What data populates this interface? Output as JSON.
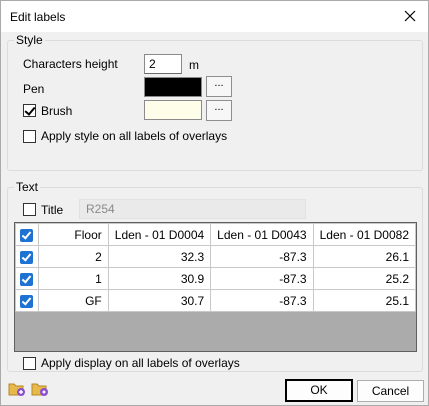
{
  "window": {
    "title": "Edit labels"
  },
  "style_group": {
    "label": "Style",
    "characters_height_label": "Characters height",
    "characters_height_value": "2",
    "unit": "m",
    "pen_label": "Pen",
    "pen_color": "#000000",
    "brush_label": "Brush",
    "brush_checked": true,
    "brush_color": "#fdfdea",
    "dots": "...",
    "apply_style_label": "Apply style on all labels of overlays"
  },
  "text_group": {
    "label": "Text",
    "title_label": "Title",
    "title_value": "R254",
    "columns": [
      "Floor",
      "Lden - 01 D0004",
      "Lden - 01 D0043",
      "Lden - 01 D0082"
    ],
    "rows": [
      {
        "checked": true,
        "cells": [
          "2",
          "32.3",
          "-87.3",
          "26.1"
        ]
      },
      {
        "checked": true,
        "cells": [
          "1",
          "30.9",
          "-87.3",
          "25.2"
        ]
      },
      {
        "checked": true,
        "cells": [
          "GF",
          "30.7",
          "-87.3",
          "25.1"
        ]
      }
    ],
    "apply_display_label": "Apply display on all labels of overlays"
  },
  "buttons": {
    "ok": "OK",
    "cancel": "Cancel"
  },
  "colors": {
    "accent": "#1e73d2",
    "grid_empty": "#ababab"
  }
}
